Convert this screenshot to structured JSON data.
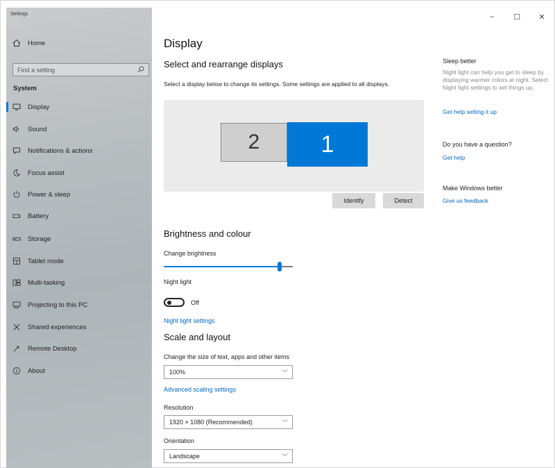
{
  "window": {
    "app_title": "Settings",
    "controls": {
      "minimize": "–",
      "maximize": "☐",
      "close": "✕"
    }
  },
  "sidebar": {
    "home_label": "Home",
    "search_placeholder": "Find a setting",
    "section": "System",
    "items": [
      {
        "label": "Display",
        "icon": "monitor-icon",
        "active": true
      },
      {
        "label": "Sound",
        "icon": "speaker-icon"
      },
      {
        "label": "Notifications & actions",
        "icon": "notification-icon"
      },
      {
        "label": "Focus assist",
        "icon": "moon-icon"
      },
      {
        "label": "Power & sleep",
        "icon": "power-icon"
      },
      {
        "label": "Battery",
        "icon": "battery-icon"
      },
      {
        "label": "Storage",
        "icon": "storage-icon"
      },
      {
        "label": "Tablet mode",
        "icon": "tablet-icon"
      },
      {
        "label": "Multi-tasking",
        "icon": "multitask-icon"
      },
      {
        "label": "Projecting to this PC",
        "icon": "projector-icon"
      },
      {
        "label": "Shared experiences",
        "icon": "shared-icon"
      },
      {
        "label": "Remote Desktop",
        "icon": "remote-icon"
      },
      {
        "label": "About",
        "icon": "info-icon"
      }
    ]
  },
  "main": {
    "title": "Display",
    "rearrange": {
      "heading": "Select and rearrange displays",
      "description": "Select a display below to change its settings. Some settings are applied to all displays.",
      "monitor_2": "2",
      "monitor_1": "1",
      "identify_label": "Identify",
      "detect_label": "Detect"
    },
    "brightness": {
      "heading": "Brightness and colour",
      "change_label": "Change brightness",
      "value_fraction": 0.88,
      "night_light_label": "Night light",
      "night_light_state": "Off",
      "night_light_settings_link": "Night light settings"
    },
    "scale": {
      "heading": "Scale and layout",
      "size_label": "Change the size of text, apps and other items",
      "size_value": "100%",
      "advanced_link": "Advanced scaling settings",
      "resolution_label": "Resolution",
      "resolution_value": "1920 × 1080 (Recommended)",
      "orientation_label": "Orientation",
      "orientation_value": "Landscape"
    }
  },
  "right": {
    "sleep_heading": "Sleep better",
    "sleep_text": "Night light can help you get to sleep by displaying warmer colors at night. Select Night light settings to set things up.",
    "sleep_link": "Get help setting it up",
    "question_heading": "Do you have a question?",
    "question_link": "Get help",
    "better_heading": "Make Windows better",
    "better_link": "Give us feedback"
  },
  "colors": {
    "accent": "#0078d7",
    "link": "#0067c0"
  }
}
